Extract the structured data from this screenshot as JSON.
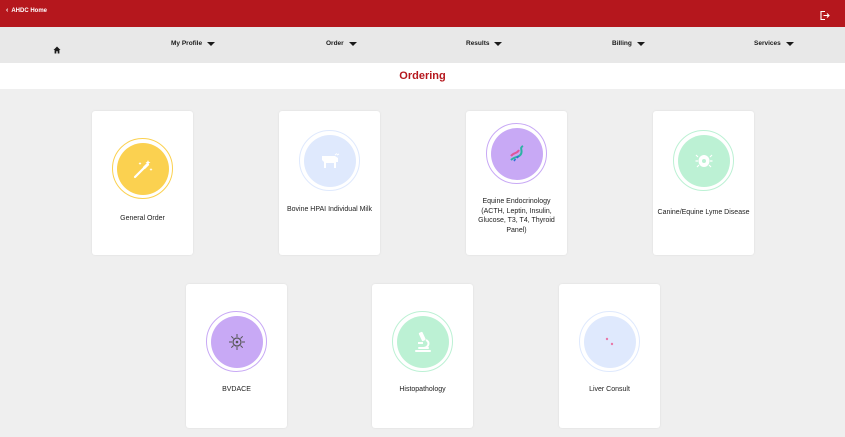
{
  "header": {
    "home_link_label": "AHDC Home",
    "logout_icon": "logout-icon"
  },
  "nav": {
    "home_icon": "home-icon",
    "items": [
      {
        "label": "My Profile"
      },
      {
        "label": "Order"
      },
      {
        "label": "Results"
      },
      {
        "label": "Billing"
      },
      {
        "label": "Services"
      }
    ]
  },
  "page": {
    "title": "Ordering"
  },
  "cards": [
    {
      "label": "General Order",
      "icon": "magic-wand-icon",
      "color": "#fbd150"
    },
    {
      "label": "Bovine HPAI Individual Milk",
      "icon": "cow-icon",
      "color": "#dfe9fd"
    },
    {
      "label": "Equine Endocrinology (ACTH, Leptin, Insulin, Glucose, T3, T4, Thyroid Panel)",
      "icon": "dna-icon",
      "color": "#c8a9f5"
    },
    {
      "label": "Canine/Equine Lyme Disease",
      "icon": "tick-icon",
      "color": "#bcf1d4"
    },
    {
      "label": "BVDACE",
      "icon": "virus-icon",
      "color": "#c8a9f5"
    },
    {
      "label": "Histopathology",
      "icon": "microscope-icon",
      "color": "#bcf1d4"
    },
    {
      "label": "Liver Consult",
      "icon": "liver-icon",
      "color": "#dfe9fd"
    }
  ]
}
